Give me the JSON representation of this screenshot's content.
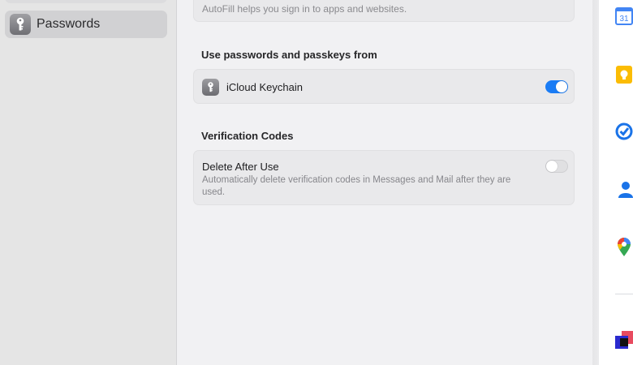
{
  "sidebar": {
    "items": [
      {
        "label": "Passwords",
        "icon": "key-icon",
        "selected": true
      }
    ]
  },
  "main": {
    "autofill": {
      "description": "AutoFill helps you sign in to apps and websites."
    },
    "sources_section": {
      "title": "Use passwords and passkeys from",
      "items": [
        {
          "label": "iCloud Keychain",
          "icon": "keychain-icon",
          "enabled": true
        }
      ]
    },
    "verification_section": {
      "title": "Verification Codes",
      "items": [
        {
          "label": "Delete After Use",
          "description": "Automatically delete verification codes in Messages and Mail after they are used.",
          "enabled": false
        }
      ]
    }
  },
  "dock": {
    "calendar_day": "31",
    "apps": [
      "google-calendar-icon",
      "google-keep-icon",
      "google-tasks-icon",
      "google-contacts-icon",
      "google-maps-icon",
      "app-icon"
    ]
  },
  "colors": {
    "accent": "#1a7cf5",
    "sidebar_bg": "#e5e5e5",
    "selected_bg": "#d1d1d3",
    "content_bg": "#f1f1f3",
    "card_bg": "#e9e9eb"
  }
}
